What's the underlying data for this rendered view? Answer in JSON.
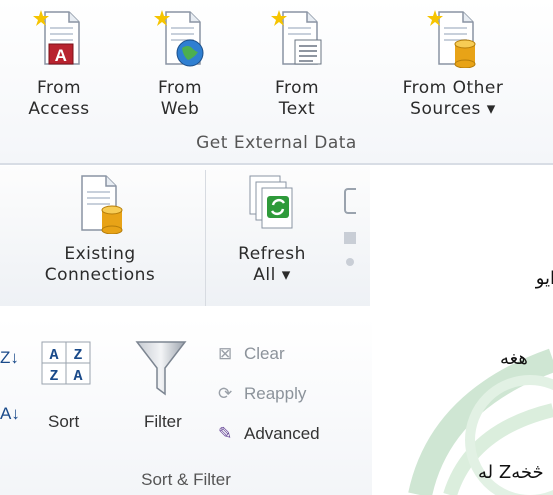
{
  "panel_top": {
    "buttons": [
      {
        "line1": "From",
        "line2": "Access",
        "icon": "access-db-icon"
      },
      {
        "line1": "From",
        "line2": "Web",
        "icon": "web-globe-icon"
      },
      {
        "line1": "From",
        "line2": "Text",
        "icon": "text-file-icon"
      },
      {
        "line1": "From Other",
        "line2": "Sources ▾",
        "icon": "database-file-icon"
      }
    ],
    "group_label": "Get External Data"
  },
  "panel_connections": {
    "existing_line1": "Existing",
    "existing_line2": "Connections",
    "refresh_line1": "Refresh",
    "refresh_line2": "All ▾"
  },
  "panel_sort": {
    "sort_label": "Sort",
    "sort_icon_top": "A Z",
    "sort_icon_bottom": "Z A",
    "filter_label": "Filter",
    "clear_label": "Clear",
    "reapply_label": "Reapply",
    "advanced_label": "Advanced",
    "group_label": "Sort & Filter"
  },
  "background_text": {
    "line1": "ايو",
    "line2": "هغه",
    "line3": "له Zڅخه"
  },
  "colors": {
    "access_red": "#b8232f",
    "db_gold": "#e8a317",
    "refresh_green": "#2e9a3a",
    "watermark_green": "#6fae7a"
  }
}
